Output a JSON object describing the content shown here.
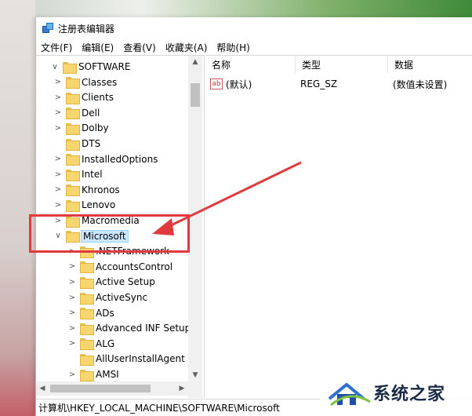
{
  "window": {
    "title": "注册表编辑器"
  },
  "menu": [
    "文件(F)",
    "编辑(E)",
    "查看(V)",
    "收藏夹(A)",
    "帮助(H)"
  ],
  "tree": [
    {
      "label": "SOFTWARE",
      "expander": "∨",
      "level": 0
    },
    {
      "label": "Classes",
      "expander": ">",
      "level": 1
    },
    {
      "label": "Clients",
      "expander": ">",
      "level": 1
    },
    {
      "label": "Dell",
      "expander": ">",
      "level": 1
    },
    {
      "label": "Dolby",
      "expander": ">",
      "level": 1
    },
    {
      "label": "DTS",
      "expander": "",
      "level": 1
    },
    {
      "label": "InstalledOptions",
      "expander": ">",
      "level": 1
    },
    {
      "label": "Intel",
      "expander": ">",
      "level": 1
    },
    {
      "label": "Khronos",
      "expander": ">",
      "level": 1
    },
    {
      "label": "Lenovo",
      "expander": ">",
      "level": 1
    },
    {
      "label": "Macromedia",
      "expander": ">",
      "level": 1
    },
    {
      "label": "Microsoft",
      "expander": "∨",
      "level": 1,
      "selected": true
    },
    {
      "label": ".NETFramework",
      "expander": ">",
      "level": 2
    },
    {
      "label": "AccountsControl",
      "expander": ">",
      "level": 2
    },
    {
      "label": "Active Setup",
      "expander": ">",
      "level": 2
    },
    {
      "label": "ActiveSync",
      "expander": ">",
      "level": 2
    },
    {
      "label": "ADs",
      "expander": ">",
      "level": 2
    },
    {
      "label": "Advanced INF Setup",
      "expander": ">",
      "level": 2
    },
    {
      "label": "ALG",
      "expander": ">",
      "level": 2
    },
    {
      "label": "AllUserInstallAgent",
      "expander": "",
      "level": 2
    },
    {
      "label": "AMSI",
      "expander": ">",
      "level": 2
    }
  ],
  "columns": {
    "name": "名称",
    "type": "类型",
    "data": "数据"
  },
  "values": [
    {
      "icon": "ab",
      "name": "(默认)",
      "type": "REG_SZ",
      "data": "(数值未设置)"
    }
  ],
  "status": {
    "path": "计算机\\HKEY_LOCAL_MACHINE\\SOFTWARE\\Microsoft"
  },
  "watermark": {
    "text": "系统之家"
  },
  "colors": {
    "selection": "#cce8ff",
    "annotation": "#e0393e",
    "folder": "#f7d670"
  },
  "icons": [
    "app-registry-icon",
    "folder-icon",
    "string-value-icon",
    "chevron-right-icon",
    "chevron-down-icon"
  ]
}
